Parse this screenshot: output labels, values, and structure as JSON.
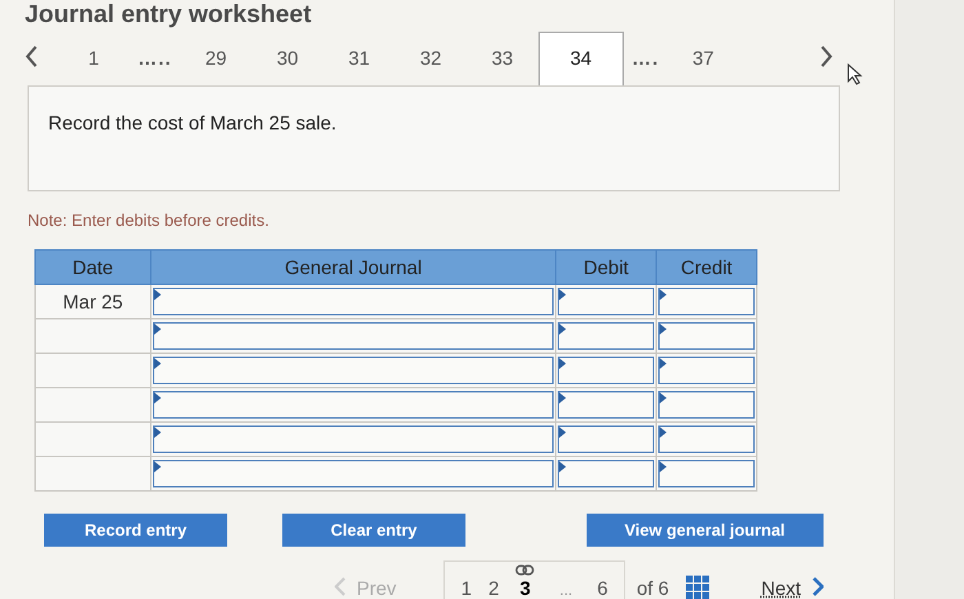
{
  "title": "Journal entry worksheet",
  "tabs": [
    {
      "label": "1",
      "kind": "page",
      "selected": false
    },
    {
      "label": "…..",
      "kind": "gap"
    },
    {
      "label": "29",
      "kind": "page",
      "selected": false
    },
    {
      "label": "30",
      "kind": "page",
      "selected": false
    },
    {
      "label": "31",
      "kind": "page",
      "selected": false
    },
    {
      "label": "32",
      "kind": "page",
      "selected": false
    },
    {
      "label": "33",
      "kind": "page",
      "selected": false
    },
    {
      "label": "34",
      "kind": "page",
      "selected": true
    },
    {
      "label": "….",
      "kind": "gap"
    },
    {
      "label": "37",
      "kind": "page",
      "selected": false
    }
  ],
  "prompt": "Record the cost of March 25 sale.",
  "note": "Note: Enter debits before credits.",
  "table": {
    "columns": [
      "Date",
      "General Journal",
      "Debit",
      "Credit"
    ],
    "rows": [
      {
        "date": "Mar 25"
      },
      {
        "date": null
      },
      {
        "date": null
      },
      {
        "date": null
      },
      {
        "date": null
      },
      {
        "date": null
      }
    ]
  },
  "buttons": [
    {
      "label": "Record entry",
      "kind": "left"
    },
    {
      "label": "Clear entry",
      "kind": "left"
    },
    {
      "label": "View general journal",
      "kind": "right"
    }
  ],
  "pager": {
    "prev": "Prev",
    "pages": [
      {
        "label": "1",
        "kind": "page",
        "selected": false
      },
      {
        "label": "2",
        "kind": "page",
        "selected": false
      },
      {
        "label": "3",
        "kind": "page",
        "selected": true
      },
      {
        "label": "...",
        "kind": "gap"
      },
      {
        "label": "6",
        "kind": "page",
        "selected": false
      }
    ],
    "total": "of 6",
    "next": "Next"
  }
}
